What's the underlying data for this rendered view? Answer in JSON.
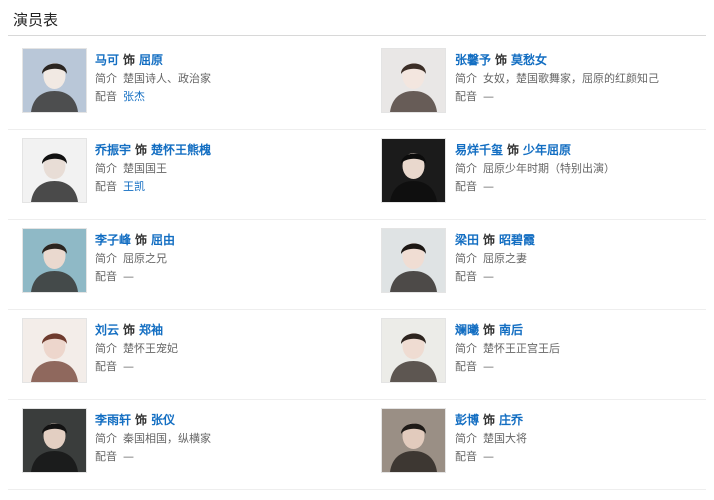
{
  "page": {
    "title": "演员表",
    "label_intro": "简介",
    "label_dub": "配音",
    "as_word": "饰"
  },
  "cast": [
    {
      "actor": "马可",
      "role": "屈原",
      "intro": "楚国诗人、政治家",
      "dub": "张杰",
      "dub_link": true,
      "photo_bg": "#b9c7d8",
      "photo_fg": "#f1e9e3",
      "photo_hair": "#2a2521"
    },
    {
      "actor": "张馨予",
      "role": "莫愁女",
      "intro": "女奴，楚国歌舞家，屈原的红颜知己",
      "dub": "—",
      "dub_link": false,
      "photo_bg": "#e9e7e6",
      "photo_fg": "#f3e6df",
      "photo_hair": "#3b2e27"
    },
    {
      "actor": "乔振宇",
      "role": "楚怀王熊槐",
      "intro": "楚国国王",
      "dub": "王凯",
      "dub_link": true,
      "photo_bg": "#f2f2f2",
      "photo_fg": "#e8ddd6",
      "photo_hair": "#111111"
    },
    {
      "actor": "易烊千玺",
      "role": "少年屈原",
      "intro": "屈原少年时期（特别出演）",
      "dub": "—",
      "dub_link": false,
      "photo_bg": "#1b1b1b",
      "photo_fg": "#e9d8cd",
      "photo_hair": "#0c0c0c"
    },
    {
      "actor": "李子峰",
      "role": "屈由",
      "intro": "屈原之兄",
      "dub": "—",
      "dub_link": false,
      "photo_bg": "#8fb9c6",
      "photo_fg": "#ead9cf",
      "photo_hair": "#2b2520"
    },
    {
      "actor": "梁田",
      "role": "昭碧霞",
      "intro": "屈原之妻",
      "dub": "—",
      "dub_link": false,
      "photo_bg": "#dfe3e4",
      "photo_fg": "#f0ddd3",
      "photo_hair": "#1c1714"
    },
    {
      "actor": "刘云",
      "role": "郑袖",
      "intro": "楚怀王宠妃",
      "dub": "—",
      "dub_link": false,
      "photo_bg": "#f3ede9",
      "photo_fg": "#edd6cc",
      "photo_hair": "#6e3b2e"
    },
    {
      "actor": "斓曦",
      "role": "南后",
      "intro": "楚怀王正宫王后",
      "dub": "—",
      "dub_link": false,
      "photo_bg": "#ecece8",
      "photo_fg": "#efdcd2",
      "photo_hair": "#2d241f"
    },
    {
      "actor": "李雨轩",
      "role": "张仪",
      "intro": "秦国相国，纵横家",
      "dub": "—",
      "dub_link": false,
      "photo_bg": "#3a3d3c",
      "photo_fg": "#e3cfc2",
      "photo_hair": "#121212"
    },
    {
      "actor": "彭博",
      "role": "庄乔",
      "intro": "楚国大将",
      "dub": "—",
      "dub_link": false,
      "photo_bg": "#9a8f85",
      "photo_fg": "#e2cbbd",
      "photo_hair": "#1e1a17"
    }
  ]
}
